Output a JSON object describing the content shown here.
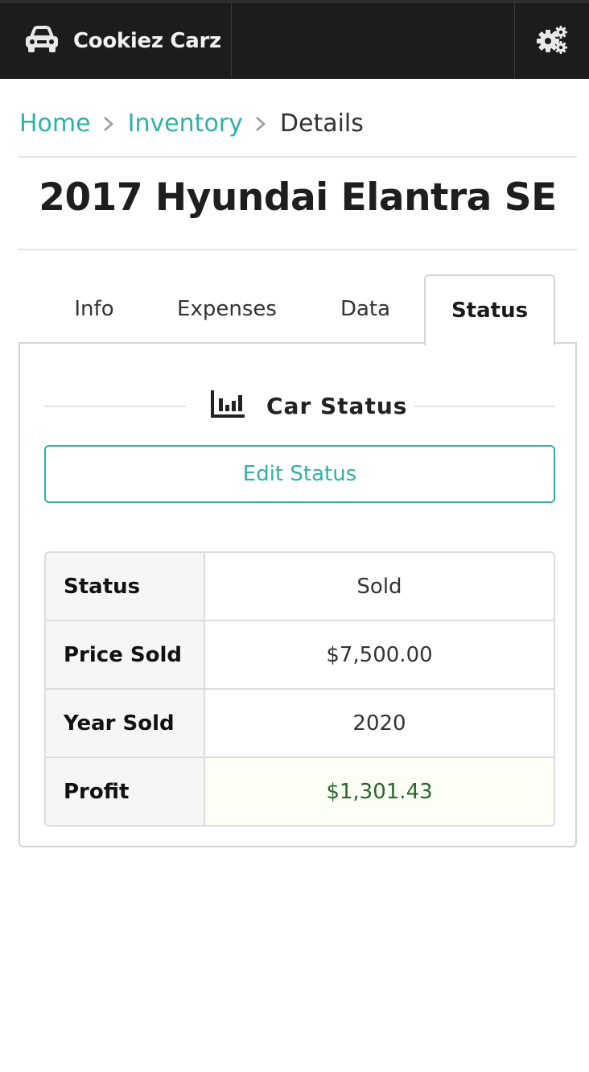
{
  "nav": {
    "brand": "Cookiez Carz",
    "brand_icon": "car-icon",
    "settings_icon": "cogs-icon"
  },
  "breadcrumb": {
    "home": "Home",
    "inventory": "Inventory",
    "current": "Details",
    "separator_icon": "chevron-right-icon"
  },
  "page": {
    "title": "2017 Hyundai Elantra SE"
  },
  "tabs": [
    {
      "label": "Info",
      "active": false
    },
    {
      "label": "Expenses",
      "active": false
    },
    {
      "label": "Data",
      "active": false
    },
    {
      "label": "Status",
      "active": true
    }
  ],
  "status_section": {
    "icon": "bar-chart-icon",
    "title": "Car Status",
    "edit_button": "Edit Status",
    "rows": [
      {
        "label": "Status",
        "value": "Sold"
      },
      {
        "label": "Price Sold",
        "value": "$7,500.00"
      },
      {
        "label": "Year Sold",
        "value": "2020"
      },
      {
        "label": "Profit",
        "value": "$1,301.43",
        "positive": true
      }
    ]
  },
  "colors": {
    "accent": "#2fb2a5",
    "navbar": "#1b1c1d",
    "positive_text": "#2c662d",
    "positive_bg": "#fbfff6"
  }
}
